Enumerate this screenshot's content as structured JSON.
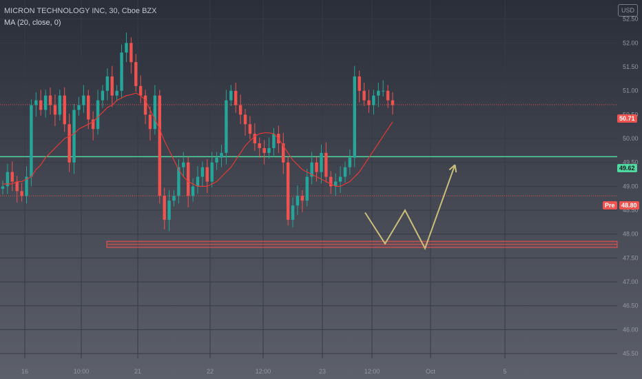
{
  "header": {
    "symbol": "MICRON TECHNOLOGY INC, 30, Cboe BZX",
    "indicator": "MA (20, close, 0)",
    "currency": "USD"
  },
  "colors": {
    "background_top": "#2a2e39",
    "background_bottom": "#5d606b",
    "up": "#26a69a",
    "down": "#ef5350",
    "ma": "#e53935",
    "level_line": "#4dd9a0",
    "drawing": "#c9bf7a",
    "support_zone": "#ef5350"
  },
  "chart_data": {
    "type": "candlestick",
    "title": "MICRON TECHNOLOGY INC, 30, Cboe BZX",
    "ylim": [
      45.4,
      52.9
    ],
    "y_ticks": [
      52.5,
      52.0,
      51.5,
      51.0,
      50.5,
      50.0,
      49.5,
      49.0,
      48.5,
      48.0,
      47.5,
      47.0,
      46.5,
      46.0,
      45.5
    ],
    "x_ticks": [
      "16",
      "10:00",
      "21",
      "22",
      "12:00",
      "23",
      "12:00",
      "Oct",
      "5"
    ],
    "series": [
      {
        "name": "MA (20, close, 0)",
        "values": [
          49.05,
          49.05,
          49.05,
          49.1,
          49.1,
          49.15,
          49.2,
          49.35,
          49.45,
          49.6,
          49.7,
          49.8,
          49.9,
          50.0,
          50.05,
          50.1,
          50.2,
          50.25,
          50.3,
          50.35,
          50.45,
          50.55,
          50.65,
          50.7,
          50.8,
          50.85,
          50.9,
          50.92,
          50.95,
          50.9,
          50.8,
          50.6,
          50.4,
          50.2,
          49.95,
          49.75,
          49.55,
          49.35,
          49.2,
          49.1,
          49.05,
          49.0,
          49.0,
          49.0,
          49.05,
          49.1,
          49.2,
          49.3,
          49.4,
          49.55,
          49.7,
          49.85,
          49.95,
          50.05,
          50.1,
          50.12,
          50.12,
          50.1,
          50.0,
          49.85,
          49.7,
          49.55,
          49.45,
          49.35,
          49.3,
          49.25,
          49.2,
          49.15,
          49.1,
          49.05,
          49.0,
          49.0,
          49.05,
          49.1,
          49.2,
          49.3,
          49.45,
          49.6,
          49.75,
          49.9,
          50.05,
          50.2,
          50.35
        ]
      },
      {
        "name": "price",
        "values": [
          49.0,
          49.3,
          49.1,
          48.9,
          48.8,
          49.2,
          50.7,
          50.8,
          50.6,
          50.9,
          50.7,
          50.5,
          50.9,
          50.3,
          49.5,
          50.6,
          50.7,
          50.9,
          50.4,
          50.2,
          50.8,
          51.0,
          51.3,
          50.9,
          51.0,
          51.8,
          52.0,
          51.6,
          51.1,
          50.9,
          50.5,
          50.2,
          50.9,
          48.8,
          48.3,
          48.7,
          48.8,
          49.4,
          49.5,
          48.8,
          49.0,
          49.2,
          49.4,
          49.1,
          49.5,
          49.6,
          49.7,
          50.8,
          51.0,
          50.7,
          50.5,
          50.3,
          50.1,
          49.9,
          49.8,
          49.7,
          49.8,
          50.1,
          49.9,
          49.5,
          48.3,
          48.6,
          48.8,
          48.7,
          49.2,
          49.5,
          49.3,
          49.7,
          49.2,
          49.0,
          49.1,
          49.2,
          49.4,
          49.6,
          51.3,
          51.0,
          50.8,
          50.7,
          50.9,
          51.0,
          51.0,
          50.8,
          50.7
        ]
      }
    ],
    "levels": {
      "last_price": 50.71,
      "horizontal_line": 49.62,
      "pre_market": 48.8,
      "support_zone": [
        47.72,
        47.85
      ]
    },
    "level_labels": [
      "50.71",
      "49.62",
      "48.80"
    ],
    "pre_label": "Pre",
    "projection": [
      [
        0,
        48.45
      ],
      [
        2,
        47.8
      ],
      [
        4,
        48.5
      ],
      [
        6,
        47.7
      ],
      [
        9,
        49.45
      ]
    ]
  }
}
